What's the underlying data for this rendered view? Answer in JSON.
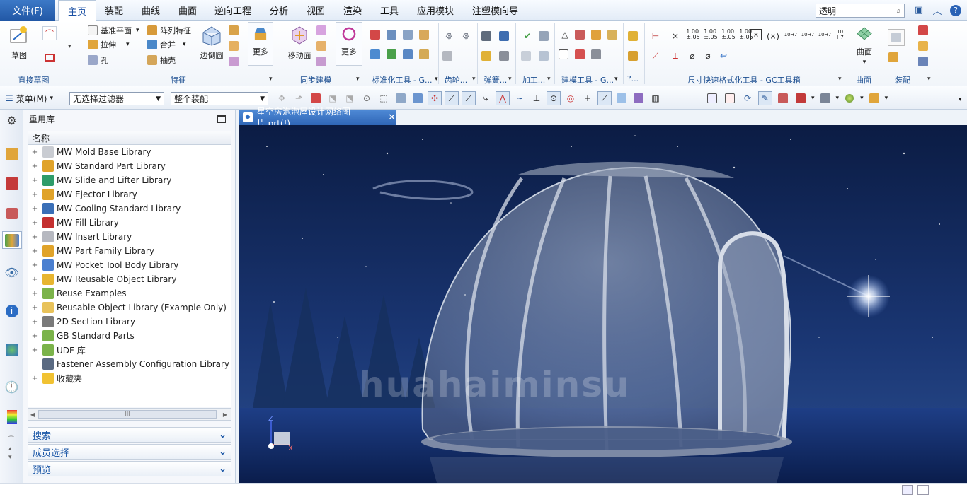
{
  "menu": {
    "file": "文件(F)",
    "tabs": [
      "主页",
      "装配",
      "曲线",
      "曲面",
      "逆向工程",
      "分析",
      "视图",
      "渲染",
      "工具",
      "应用模块",
      "注塑模向导"
    ],
    "search_value": "透明"
  },
  "ribbon": {
    "sketch_label": "草图",
    "direct_sketch_group": "直接草图",
    "datum_plane": "基准平面",
    "pattern_feature": "阵列特征",
    "extrude": "拉伸",
    "unite": "合并",
    "hole": "孔",
    "shell": "抽壳",
    "edge_blend": "边倒圆",
    "more1": "更多",
    "feature_group": "特征",
    "move_face": "移动面",
    "more2": "更多",
    "sync_group": "同步建模",
    "std_tools_group": "标准化工具 - G...",
    "gear_group": "齿轮...",
    "spring_group": "弹簧...",
    "machining_group": "加工...",
    "modeling_tools_group": "建模工具 - G...",
    "q_group": "?...",
    "dim_group": "尺寸快速格式化工具 - GC工具箱",
    "surface": "曲面",
    "surface_group": "曲面",
    "assembly_group": "装配",
    "dim_labels": [
      "1.00\n±.05",
      "1.00\n±.05",
      "1.00\n±.05",
      "1.00\n±.05",
      "10H7",
      "10H7",
      "10H7",
      "10\nH7"
    ]
  },
  "toolbar2": {
    "menu": "菜单(M)",
    "filter": "无选择过滤器",
    "scope": "整个装配"
  },
  "panel": {
    "title": "重用库",
    "column": "名称",
    "items": [
      {
        "label": "MW Mold Base Library",
        "color": "#c9ccd2"
      },
      {
        "label": "MW Standard Part Library",
        "color": "#e0a32a"
      },
      {
        "label": "MW Slide and Lifter Library",
        "color": "#2e9c6a"
      },
      {
        "label": "MW Ejector Library",
        "color": "#e0a32a"
      },
      {
        "label": "MW Cooling Standard Library",
        "color": "#3a6fb7"
      },
      {
        "label": "MW Fill Library",
        "color": "#c43030"
      },
      {
        "label": "MW Insert Library",
        "color": "#b6b8c0"
      },
      {
        "label": "MW Part Family Library",
        "color": "#e0a32a"
      },
      {
        "label": "MW Pocket Tool Body Library",
        "color": "#4a7fd0"
      },
      {
        "label": "MW Reusable Object Library",
        "color": "#e7b530"
      },
      {
        "label": "Reuse Examples",
        "color": "#7bb34a"
      },
      {
        "label": "Reusable Object Library (Example Only)",
        "color": "#e8c25a"
      },
      {
        "label": "2D Section Library",
        "color": "#7a7a7a"
      },
      {
        "label": "GB Standard Parts",
        "color": "#7bb34a"
      },
      {
        "label": "UDF 库",
        "color": "#7bb34a"
      },
      {
        "label": "Fastener Assembly Configuration Library",
        "color": "#5a6a82"
      },
      {
        "label": "收藏夹",
        "color": "#f1c232"
      }
    ],
    "sections": [
      "搜索",
      "成员选择",
      "预览"
    ]
  },
  "viewport": {
    "tab_title": "星空房泡泡屋设计网络图片.prt(!)",
    "watermark": "huahaiminsu"
  }
}
